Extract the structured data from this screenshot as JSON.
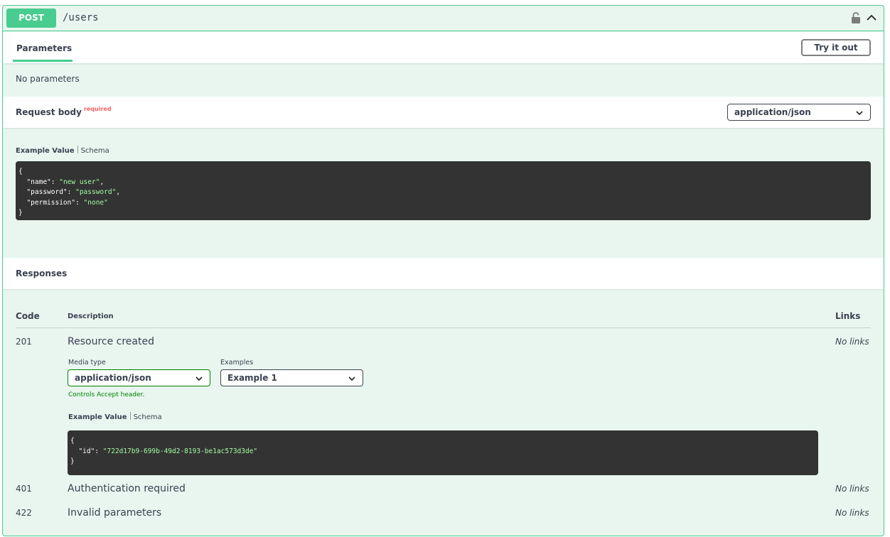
{
  "operation": {
    "method": "POST",
    "path": "/users",
    "colors": {
      "accent": "#49cc90",
      "background": "#e8f6ef",
      "code_bg": "#333333",
      "string": "#a2fca2",
      "required": "#ff6060"
    }
  },
  "parameters": {
    "tab_label": "Parameters",
    "try_button": "Try it out",
    "empty_text": "No parameters"
  },
  "request_body": {
    "title": "Request body",
    "required_label": "required",
    "content_type": "application/json",
    "tab_example": "Example Value",
    "tab_schema": "Schema",
    "example": {
      "open": "{",
      "lines": [
        {
          "key": "\"name\"",
          "value": "\"new user\"",
          "trail": ","
        },
        {
          "key": "\"password\"",
          "value": "\"password\"",
          "trail": ","
        },
        {
          "key": "\"permission\"",
          "value": "\"none\"",
          "trail": ""
        }
      ],
      "close": "}"
    }
  },
  "responses": {
    "title": "Responses",
    "headers": {
      "code": "Code",
      "description": "Description",
      "links": "Links"
    },
    "items": [
      {
        "code": "201",
        "description": "Resource created",
        "links": "No links",
        "media_type_label": "Media type",
        "media_type": "application/json",
        "examples_label": "Examples",
        "example_name": "Example 1",
        "controls_text": "Controls Accept header.",
        "tab_example": "Example Value",
        "tab_schema": "Schema",
        "example": {
          "open": "{",
          "key": "\"id\"",
          "value": "\"722d17b9-699b-49d2-8193-be1ac573d3de\"",
          "close": "}"
        }
      },
      {
        "code": "401",
        "description": "Authentication required",
        "links": "No links"
      },
      {
        "code": "422",
        "description": "Invalid parameters",
        "links": "No links"
      }
    ]
  }
}
